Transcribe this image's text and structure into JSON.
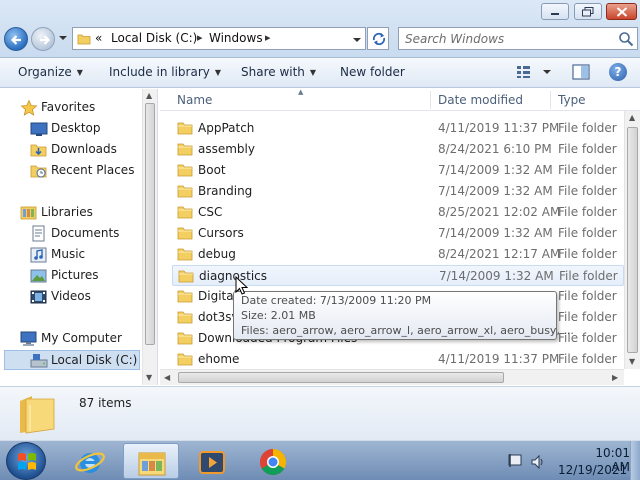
{
  "window": {
    "breadcrumb_overflow": "«",
    "breadcrumb": [
      "Local Disk (C:)",
      "Windows"
    ],
    "search_placeholder": "Search Windows"
  },
  "commands": {
    "organize": "Organize",
    "include_in_library": "Include in library",
    "share_with": "Share with",
    "new_folder": "New folder"
  },
  "nav": {
    "favorites": "Favorites",
    "desktop": "Desktop",
    "downloads": "Downloads",
    "recent_places": "Recent Places",
    "libraries": "Libraries",
    "documents": "Documents",
    "music": "Music",
    "pictures": "Pictures",
    "videos": "Videos",
    "my_computer": "My Computer",
    "local_disk": "Local Disk (C:)"
  },
  "columns": {
    "name": "Name",
    "date_modified": "Date modified",
    "type": "Type"
  },
  "files": [
    {
      "name": "AppPatch",
      "date": "4/11/2019 11:37 PM",
      "type": "File folder"
    },
    {
      "name": "assembly",
      "date": "8/24/2021 6:10 PM",
      "type": "File folder"
    },
    {
      "name": "Boot",
      "date": "7/14/2009 1:32 AM",
      "type": "File folder"
    },
    {
      "name": "Branding",
      "date": "7/14/2009 1:32 AM",
      "type": "File folder"
    },
    {
      "name": "CSC",
      "date": "8/25/2021 12:02 AM",
      "type": "File folder"
    },
    {
      "name": "Cursors",
      "date": "7/14/2009 1:32 AM",
      "type": "File folder"
    },
    {
      "name": "debug",
      "date": "8/24/2021 12:17 AM",
      "type": "File folder"
    },
    {
      "name": "diagnostics",
      "date": "7/14/2009 1:32 AM",
      "type": "File folder"
    },
    {
      "name": "Digitall",
      "date": "",
      "type": "File folder"
    },
    {
      "name": "dot3sv",
      "date": "",
      "type": "File folder"
    },
    {
      "name": "Downloaded Program Files",
      "date": "",
      "type": "File folder"
    },
    {
      "name": "ehome",
      "date": "4/11/2019 11:37 PM",
      "type": "File folder"
    }
  ],
  "tooltip": {
    "date_created": "Date created: 7/13/2009 11:20 PM",
    "size": "Size: 2.01 MB",
    "files": "Files: aero_arrow, aero_arrow_l, aero_arrow_xl, aero_busy, ..."
  },
  "details": {
    "item_count": "87 items"
  },
  "taskbar": {
    "time": "10:01 AM",
    "date": "12/19/2021"
  },
  "colors": {
    "folder": "#f3cf62",
    "selection": "#cfdff2",
    "accent": "#2b6fc1"
  }
}
